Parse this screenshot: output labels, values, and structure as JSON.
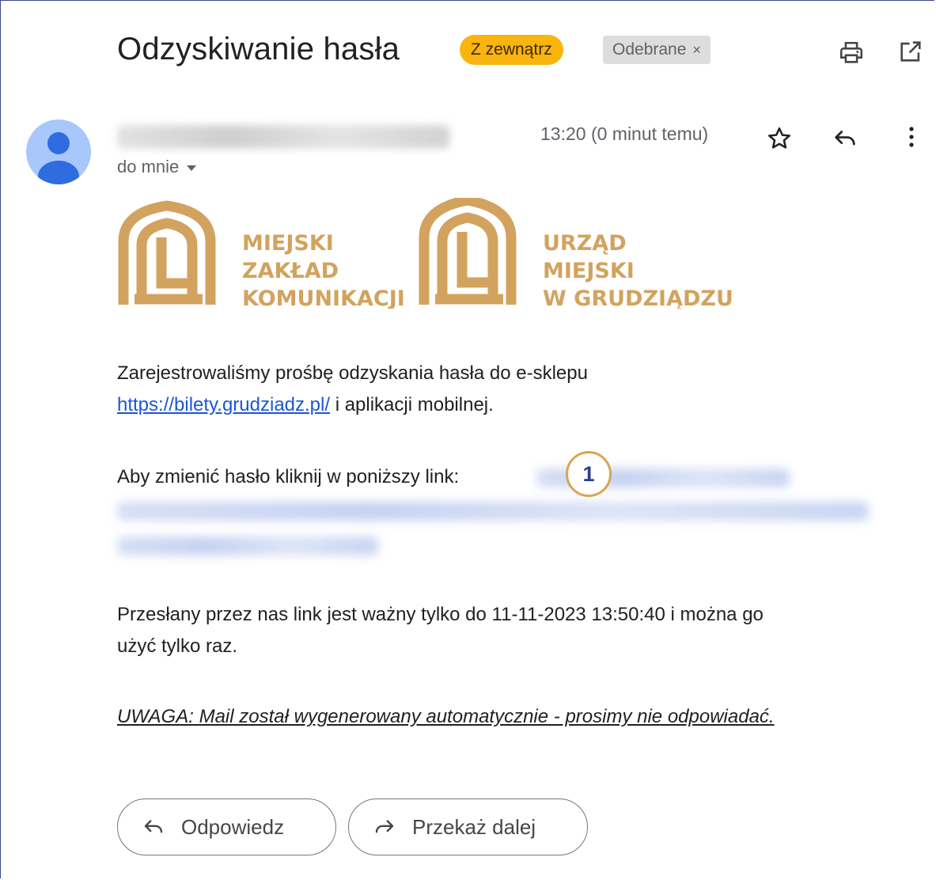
{
  "email": {
    "subject": "Odzyskiwanie hasła",
    "labels": {
      "external": "Z zewnątrz",
      "inbox": "Odebrane",
      "inbox_remove": "×"
    },
    "toolbar_icons": [
      "print-icon",
      "open-in-new-window-icon"
    ],
    "recipient": "do mnie",
    "time": "13:20 (0 minut temu)",
    "header_icons": [
      "star-icon",
      "reply-icon",
      "more-vert-icon"
    ]
  },
  "logos": {
    "left": {
      "line1": "MIEJSKI",
      "line2": "ZAKŁAD",
      "line3": "KOMUNIKACJI"
    },
    "right": {
      "line1": "URZĄD",
      "line2": "MIEJSKI",
      "line3": "W GRUDZIĄDZU"
    },
    "color": "#d2a35e"
  },
  "body": {
    "para1_text": "Zarejestrowaliśmy prośbę odzyskania hasła do e-sklepu",
    "para1_link": "https://bilety.grudziadz.pl/",
    "para1_tail": " i aplikacji mobilnej.",
    "para2_text": "Aby zmienić hasło kliknij w poniższy link: ",
    "para3_line1": "Przesłany przez nas link jest ważny tylko do 11-11-2023 13:50:40 i można go",
    "para3_line2": "użyć tylko raz.",
    "warning": "UWAGA: Mail został wygenerowany automatycznie - prosimy nie odpowiadać."
  },
  "marker": {
    "number": "1",
    "border_color": "#d9a552",
    "text_color": "#2a3f8f"
  },
  "actions": {
    "reply_label": "Odpowiedz",
    "forward_label": "Przekaż dalej"
  }
}
